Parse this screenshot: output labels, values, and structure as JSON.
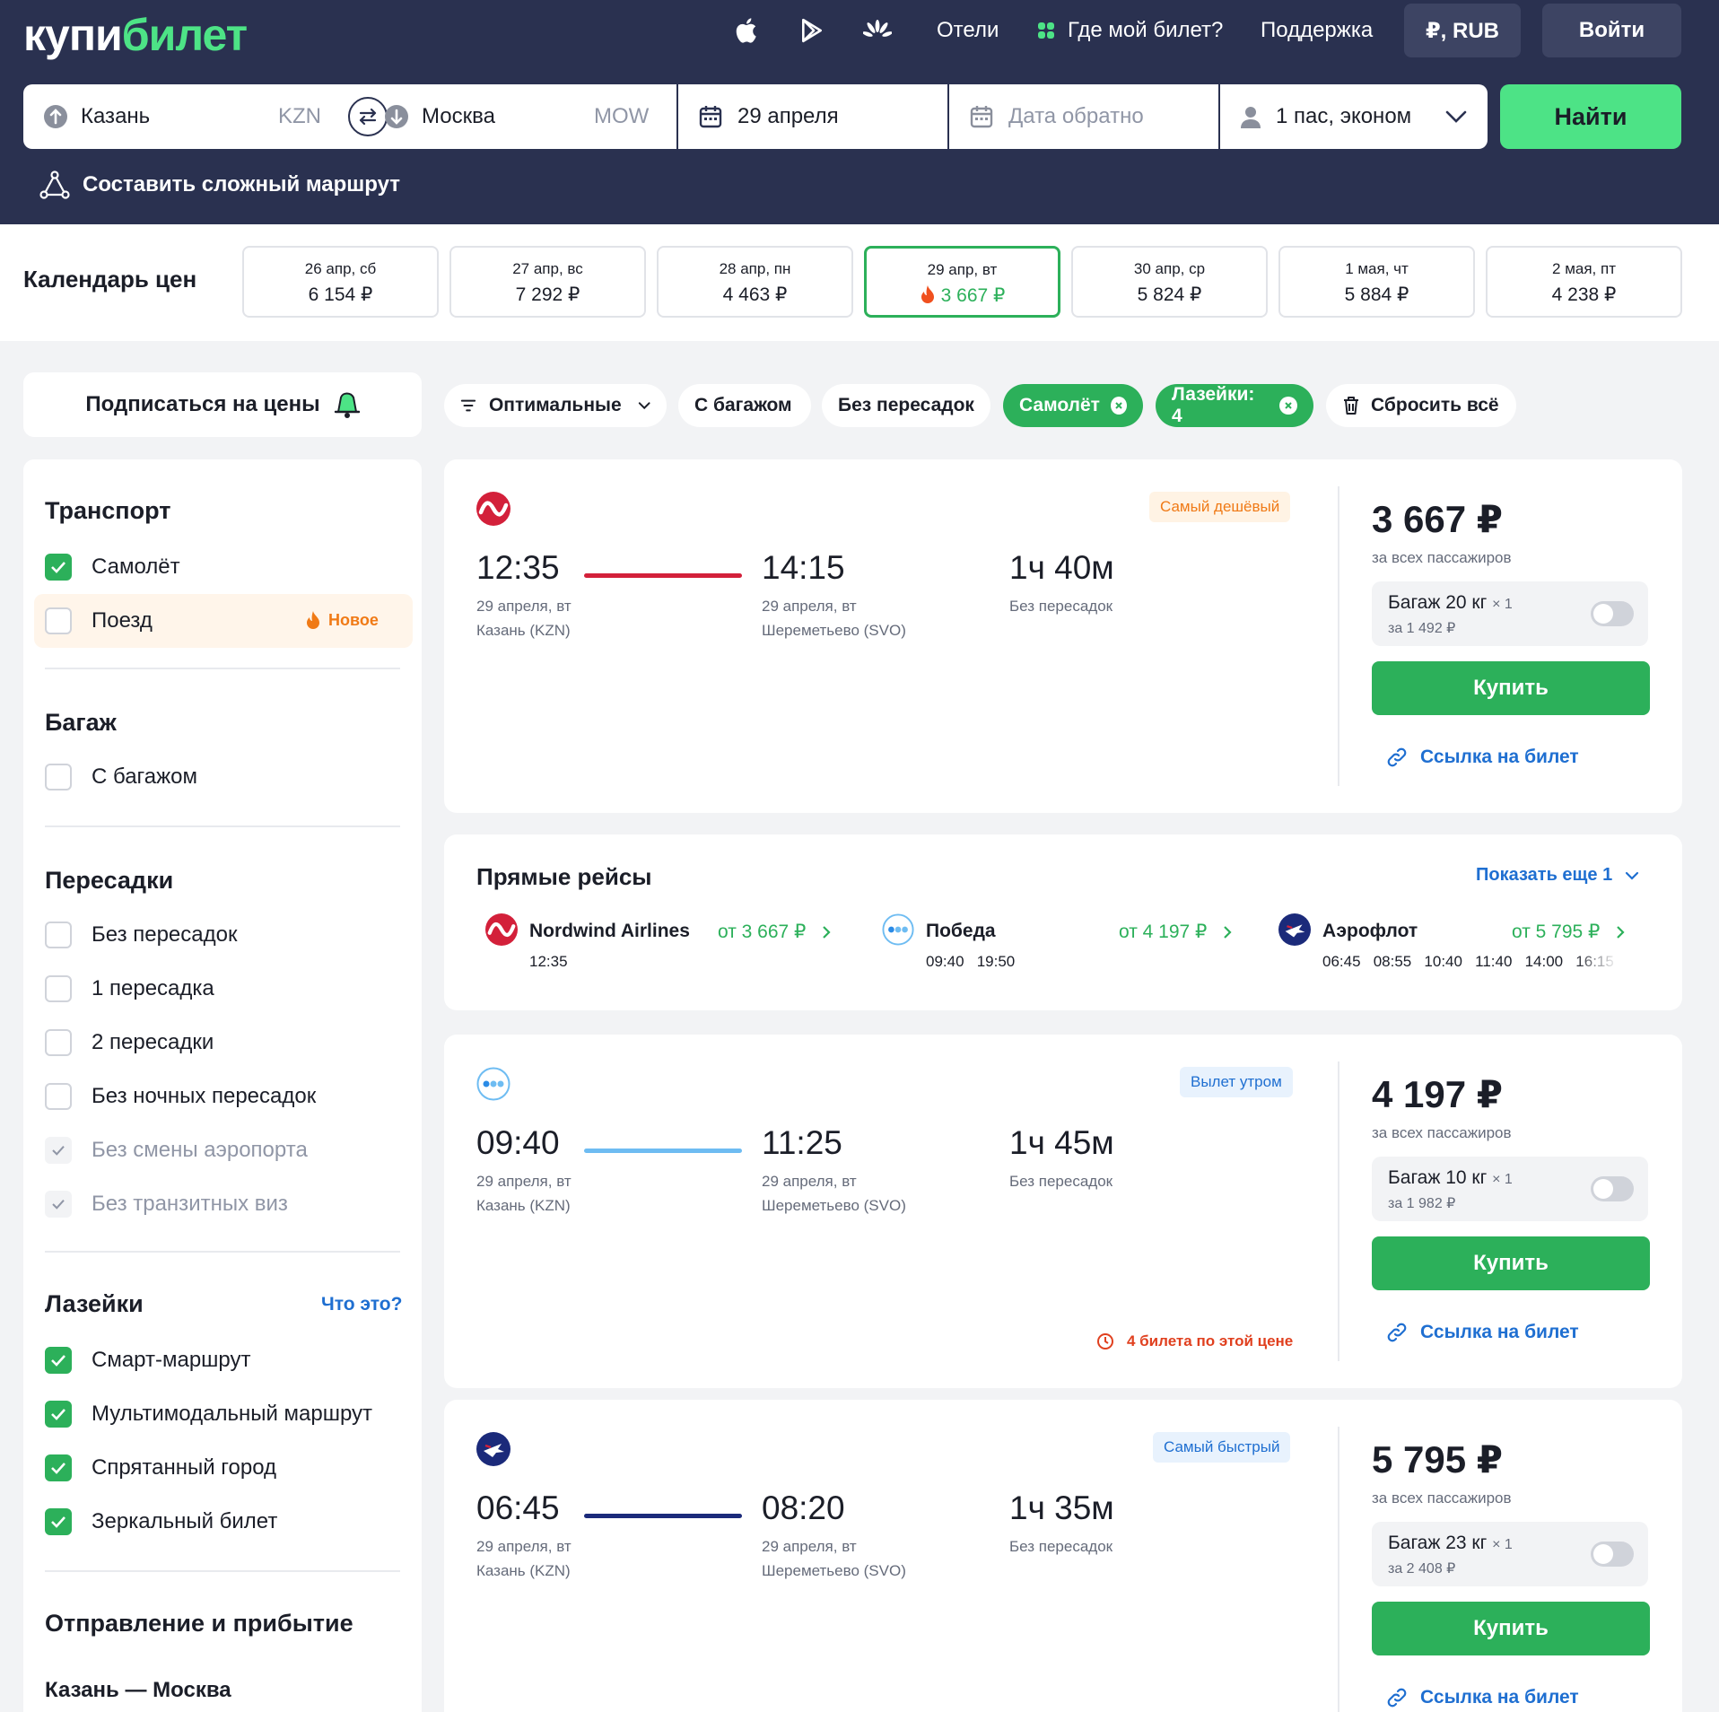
{
  "header": {
    "logo_a": "купи",
    "logo_b": "билет",
    "nav": {
      "hotels": "Отели",
      "where_ticket": "Где мой билет?",
      "support": "Поддержка"
    },
    "currency": "₽, RUB",
    "login": "Войти"
  },
  "search": {
    "from_city": "Казань",
    "from_code": "KZN",
    "to_city": "Москва",
    "to_code": "MOW",
    "date": "29 апреля",
    "return_placeholder": "Дата обратно",
    "passengers": "1 пас, эконом",
    "find": "Найти",
    "complex_route": "Составить сложный маршрут"
  },
  "calendar": {
    "title": "Календарь цен",
    "days": [
      {
        "date": "26 апр, сб",
        "price": "6 154 ₽"
      },
      {
        "date": "27 апр, вс",
        "price": "7 292 ₽"
      },
      {
        "date": "28 апр, пн",
        "price": "4 463 ₽"
      },
      {
        "date": "29 апр, вт",
        "price": "3 667 ₽"
      },
      {
        "date": "30 апр, ср",
        "price": "5 824 ₽"
      },
      {
        "date": "1 мая, чт",
        "price": "5 884 ₽"
      },
      {
        "date": "2 мая, пт",
        "price": "4 238 ₽"
      }
    ]
  },
  "subscribe": "Подписаться на цены",
  "chips": {
    "sort": "Оптимальные",
    "baggage": "С багажом",
    "direct": "Без пересадок",
    "plane": "Самолёт",
    "loopholes": "Лазейки: 4",
    "reset": "Сбросить всё"
  },
  "filters": {
    "transport": {
      "title": "Транспорт",
      "plane": "Самолёт",
      "train": "Поезд",
      "new": "Новое"
    },
    "baggage": {
      "title": "Багаж",
      "with": "С багажом"
    },
    "transfers": {
      "title": "Пересадки",
      "none": "Без пересадок",
      "one": "1 пересадка",
      "two": "2 пересадки",
      "no_night": "Без ночных пересадок",
      "no_airport_change": "Без смены аэропорта",
      "no_transit_visa": "Без транзитных виз"
    },
    "loopholes": {
      "title": "Лазейки",
      "what": "Что это?",
      "smart": "Смарт-маршрут",
      "multimodal": "Мультимодальный маршрут",
      "hidden_city": "Спрятанный город",
      "mirror": "Зеркальный билет"
    },
    "depart_arrive": {
      "title": "Отправление и прибытие",
      "route": "Казань — Москва"
    }
  },
  "flights": [
    {
      "badge": "Самый дешёвый",
      "dep_time": "12:35",
      "dep_date": "29 апреля, вт",
      "dep_airport": "Казань (KZN)",
      "arr_time": "14:15",
      "arr_date": "29 апреля, вт",
      "arr_airport": "Шереметьево (SVO)",
      "duration": "1ч 40м",
      "stops": "Без пересадок",
      "price": "3 667 ₽",
      "price_for": "за всех пассажиров",
      "bag": "Багаж 20 кг",
      "bag_qty": "× 1",
      "bag_price": "за 1 492 ₽",
      "buy": "Купить",
      "link": "Ссылка на билет",
      "line_color": "#d3203a"
    },
    {
      "badge": "Вылет утром",
      "dep_time": "09:40",
      "dep_date": "29 апреля, вт",
      "dep_airport": "Казань (KZN)",
      "arr_time": "11:25",
      "arr_date": "29 апреля, вт",
      "arr_airport": "Шереметьево (SVO)",
      "duration": "1ч 45м",
      "stops": "Без пересадок",
      "price": "4 197 ₽",
      "price_for": "за всех пассажиров",
      "bag": "Багаж 10 кг",
      "bag_qty": "× 1",
      "bag_price": "за 1 982 ₽",
      "buy": "Купить",
      "link": "Ссылка на билет",
      "warning": "4 билета по этой цене",
      "line_color": "#6ebcf2"
    },
    {
      "badge": "Самый быстрый",
      "dep_time": "06:45",
      "dep_date": "29 апреля, вт",
      "dep_airport": "Казань (KZN)",
      "arr_time": "08:20",
      "arr_date": "29 апреля, вт",
      "arr_airport": "Шереметьево (SVO)",
      "duration": "1ч 35м",
      "stops": "Без пересадок",
      "price": "5 795 ₽",
      "price_for": "за всех пассажиров",
      "bag": "Багаж 23 кг",
      "bag_qty": "× 1",
      "bag_price": "за 2 408 ₽",
      "buy": "Купить",
      "link": "Ссылка на билет",
      "line_color": "#1b2a7a"
    }
  ],
  "direct": {
    "title": "Прямые рейсы",
    "show_more": "Показать еще 1",
    "airlines": [
      {
        "name": "Nordwind Airlines",
        "price": "от 3 667 ₽",
        "times": "12:35"
      },
      {
        "name": "Победа",
        "price": "от 4 197 ₽",
        "times": "09:40   19:50"
      },
      {
        "name": "Аэрофлот",
        "price": "от 5 795 ₽",
        "times": "06:45   08:55   10:40   11:40   14:00   16:15"
      }
    ]
  },
  "colors": {
    "accent": "#4de386",
    "green": "#2cb05a",
    "navy": "#2a3150",
    "link": "#1f6fd1",
    "orange": "#f07a16",
    "red": "#e0401f"
  }
}
